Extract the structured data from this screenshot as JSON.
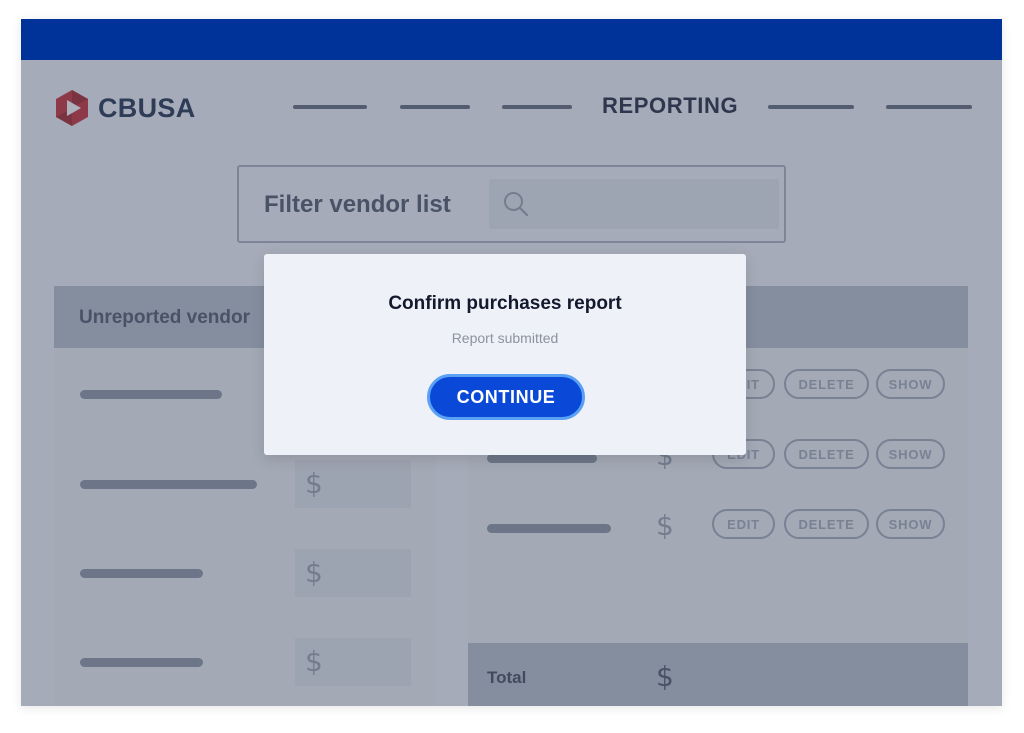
{
  "brand": {
    "name": "CBUSA",
    "colors": {
      "topbar": "#003399",
      "logo_red": "#c8252c",
      "button": "#0a49d8"
    }
  },
  "nav": {
    "active_label": "REPORTING"
  },
  "filter": {
    "label": "Filter vendor list",
    "icon": "search-icon"
  },
  "unreported": {
    "header": "Unreported vendor",
    "currency_symbol": "$"
  },
  "reported": {
    "currency_symbol": "$",
    "actions": {
      "edit": "EDIT",
      "delete": "DELETE",
      "show": "SHOW"
    },
    "total_label": "Total",
    "total_currency": "$"
  },
  "modal": {
    "title": "Confirm purchases report",
    "subtitle": "Report submitted",
    "button": "CONTINUE"
  }
}
